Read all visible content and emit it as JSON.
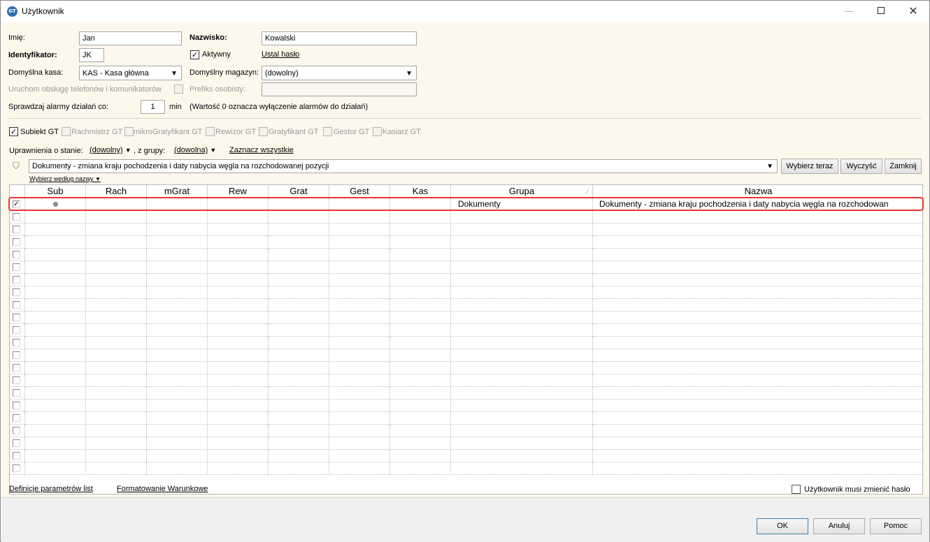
{
  "window": {
    "title": "Użytkownik",
    "icon_text": "GT",
    "minimize_glyph": "—",
    "close_glyph": "✕"
  },
  "form": {
    "first_name": {
      "label": "Imię:",
      "value": "Jan"
    },
    "last_name": {
      "label": "Nazwisko:",
      "value": "Kowalski"
    },
    "identifier": {
      "label": "Identyfikator:",
      "value": "JK"
    },
    "active": {
      "label": "Aktywny",
      "checked": true
    },
    "set_password_link": "Ustal hasło",
    "default_cash": {
      "label": "Domyślna kasa:",
      "value": "KAS - Kasa główna"
    },
    "default_warehouse": {
      "label": "Domyślny magazyn:",
      "value": "(dowolny)"
    },
    "phone_service": {
      "label": "Uruchom obsługę telefonów i komunikatorów",
      "checked": false,
      "disabled": true
    },
    "personal_prefix": {
      "label": "Prefiks osobisty:",
      "value": "",
      "disabled": true
    },
    "alarm_check": {
      "label": "Sprawdzaj alarmy działań co:",
      "value": "1",
      "unit": "min",
      "note": "(Wartość 0 oznacza wyłączenie alarmów do działań)"
    }
  },
  "modules": [
    {
      "label": "Subiekt GT",
      "checked": true,
      "enabled": true
    },
    {
      "label": "Rachmistrz GT",
      "checked": false,
      "enabled": false
    },
    {
      "label": "mikroGratyfikant GT",
      "checked": false,
      "enabled": false
    },
    {
      "label": "Rewizor GT",
      "checked": false,
      "enabled": false
    },
    {
      "label": "Gratyfikant GT",
      "checked": false,
      "enabled": false
    },
    {
      "label": "Gestor GT",
      "checked": false,
      "enabled": false
    },
    {
      "label": "Kasiarz GT",
      "checked": false,
      "enabled": false
    }
  ],
  "permissions": {
    "state_label": "Uprawnienia o stanie:",
    "state_value": "(dowolny)",
    "group_label": ", z grupy:",
    "group_value": "(dowolna)",
    "select_all_link": "Zaznacz wszystkie",
    "filter_value": "Dokumenty - zmiana kraju pochodzenia i daty nabycia węgla na rozchodowanej pozycji",
    "select_now_button": "Wybierz teraz",
    "clear_button": "Wyczyść",
    "close_button": "Zamknij",
    "select_by_name": "Wybierz według nazwy"
  },
  "grid": {
    "columns": [
      "Sub",
      "Rach",
      "mGrat",
      "Rew",
      "Grat",
      "Gest",
      "Kas",
      "Grupa",
      "Nazwa"
    ],
    "sorted_column": "Grupa",
    "rows": [
      {
        "checked": true,
        "sub": true,
        "group": "Dokumenty",
        "name": "Dokumenty - zmiana kraju pochodzenia i daty nabycia węgla na rozchodowan",
        "highlighted": true
      }
    ],
    "empty_rows": 21
  },
  "footer": {
    "list_params_link": "Definicje parametrów list",
    "conditional_format_link": "Formatowanie Warunkowe",
    "must_change_password": {
      "label": "Użytkownik musi zmienić hasło",
      "checked": false
    }
  },
  "buttons": {
    "ok": "OK",
    "cancel": "Anuluj",
    "help": "Pomoc"
  },
  "colors": {
    "form_background": "#fdf8ec",
    "highlight_border": "#e33333"
  }
}
